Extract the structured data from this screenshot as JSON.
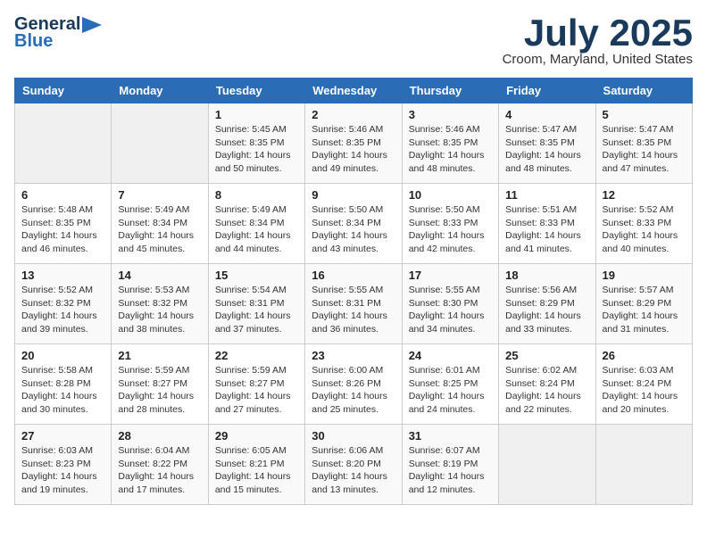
{
  "header": {
    "logo_line1": "General",
    "logo_line2": "Blue",
    "month": "July 2025",
    "location": "Croom, Maryland, United States"
  },
  "weekdays": [
    "Sunday",
    "Monday",
    "Tuesday",
    "Wednesday",
    "Thursday",
    "Friday",
    "Saturday"
  ],
  "weeks": [
    [
      {
        "day": "",
        "info": ""
      },
      {
        "day": "",
        "info": ""
      },
      {
        "day": "1",
        "info": "Sunrise: 5:45 AM\nSunset: 8:35 PM\nDaylight: 14 hours\nand 50 minutes."
      },
      {
        "day": "2",
        "info": "Sunrise: 5:46 AM\nSunset: 8:35 PM\nDaylight: 14 hours\nand 49 minutes."
      },
      {
        "day": "3",
        "info": "Sunrise: 5:46 AM\nSunset: 8:35 PM\nDaylight: 14 hours\nand 48 minutes."
      },
      {
        "day": "4",
        "info": "Sunrise: 5:47 AM\nSunset: 8:35 PM\nDaylight: 14 hours\nand 48 minutes."
      },
      {
        "day": "5",
        "info": "Sunrise: 5:47 AM\nSunset: 8:35 PM\nDaylight: 14 hours\nand 47 minutes."
      }
    ],
    [
      {
        "day": "6",
        "info": "Sunrise: 5:48 AM\nSunset: 8:35 PM\nDaylight: 14 hours\nand 46 minutes."
      },
      {
        "day": "7",
        "info": "Sunrise: 5:49 AM\nSunset: 8:34 PM\nDaylight: 14 hours\nand 45 minutes."
      },
      {
        "day": "8",
        "info": "Sunrise: 5:49 AM\nSunset: 8:34 PM\nDaylight: 14 hours\nand 44 minutes."
      },
      {
        "day": "9",
        "info": "Sunrise: 5:50 AM\nSunset: 8:34 PM\nDaylight: 14 hours\nand 43 minutes."
      },
      {
        "day": "10",
        "info": "Sunrise: 5:50 AM\nSunset: 8:33 PM\nDaylight: 14 hours\nand 42 minutes."
      },
      {
        "day": "11",
        "info": "Sunrise: 5:51 AM\nSunset: 8:33 PM\nDaylight: 14 hours\nand 41 minutes."
      },
      {
        "day": "12",
        "info": "Sunrise: 5:52 AM\nSunset: 8:33 PM\nDaylight: 14 hours\nand 40 minutes."
      }
    ],
    [
      {
        "day": "13",
        "info": "Sunrise: 5:52 AM\nSunset: 8:32 PM\nDaylight: 14 hours\nand 39 minutes."
      },
      {
        "day": "14",
        "info": "Sunrise: 5:53 AM\nSunset: 8:32 PM\nDaylight: 14 hours\nand 38 minutes."
      },
      {
        "day": "15",
        "info": "Sunrise: 5:54 AM\nSunset: 8:31 PM\nDaylight: 14 hours\nand 37 minutes."
      },
      {
        "day": "16",
        "info": "Sunrise: 5:55 AM\nSunset: 8:31 PM\nDaylight: 14 hours\nand 36 minutes."
      },
      {
        "day": "17",
        "info": "Sunrise: 5:55 AM\nSunset: 8:30 PM\nDaylight: 14 hours\nand 34 minutes."
      },
      {
        "day": "18",
        "info": "Sunrise: 5:56 AM\nSunset: 8:29 PM\nDaylight: 14 hours\nand 33 minutes."
      },
      {
        "day": "19",
        "info": "Sunrise: 5:57 AM\nSunset: 8:29 PM\nDaylight: 14 hours\nand 31 minutes."
      }
    ],
    [
      {
        "day": "20",
        "info": "Sunrise: 5:58 AM\nSunset: 8:28 PM\nDaylight: 14 hours\nand 30 minutes."
      },
      {
        "day": "21",
        "info": "Sunrise: 5:59 AM\nSunset: 8:27 PM\nDaylight: 14 hours\nand 28 minutes."
      },
      {
        "day": "22",
        "info": "Sunrise: 5:59 AM\nSunset: 8:27 PM\nDaylight: 14 hours\nand 27 minutes."
      },
      {
        "day": "23",
        "info": "Sunrise: 6:00 AM\nSunset: 8:26 PM\nDaylight: 14 hours\nand 25 minutes."
      },
      {
        "day": "24",
        "info": "Sunrise: 6:01 AM\nSunset: 8:25 PM\nDaylight: 14 hours\nand 24 minutes."
      },
      {
        "day": "25",
        "info": "Sunrise: 6:02 AM\nSunset: 8:24 PM\nDaylight: 14 hours\nand 22 minutes."
      },
      {
        "day": "26",
        "info": "Sunrise: 6:03 AM\nSunset: 8:24 PM\nDaylight: 14 hours\nand 20 minutes."
      }
    ],
    [
      {
        "day": "27",
        "info": "Sunrise: 6:03 AM\nSunset: 8:23 PM\nDaylight: 14 hours\nand 19 minutes."
      },
      {
        "day": "28",
        "info": "Sunrise: 6:04 AM\nSunset: 8:22 PM\nDaylight: 14 hours\nand 17 minutes."
      },
      {
        "day": "29",
        "info": "Sunrise: 6:05 AM\nSunset: 8:21 PM\nDaylight: 14 hours\nand 15 minutes."
      },
      {
        "day": "30",
        "info": "Sunrise: 6:06 AM\nSunset: 8:20 PM\nDaylight: 14 hours\nand 13 minutes."
      },
      {
        "day": "31",
        "info": "Sunrise: 6:07 AM\nSunset: 8:19 PM\nDaylight: 14 hours\nand 12 minutes."
      },
      {
        "day": "",
        "info": ""
      },
      {
        "day": "",
        "info": ""
      }
    ]
  ]
}
